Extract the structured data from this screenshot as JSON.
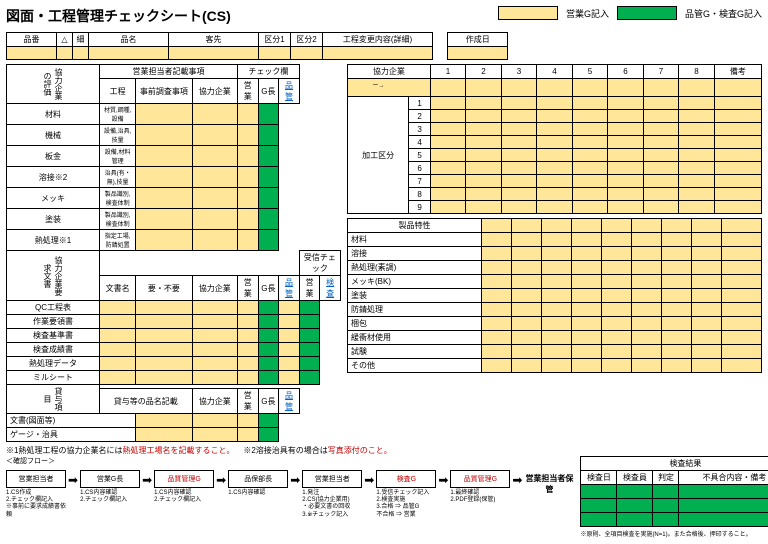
{
  "title": "図面・工程管理チェックシート(CS)",
  "legend": {
    "yellow": "営業G記入",
    "green": "品管G・検査G記入"
  },
  "header": {
    "hinban": "品番",
    "delta": "△",
    "sai": "細",
    "hinmei": "品名",
    "kyakusaki": "客先",
    "kubun1": "区分1",
    "kubun2": "区分2",
    "koutei_henkou": "工程変更内容(詳細)",
    "sakuseibi": "作成日"
  },
  "sales_section": {
    "title": "営業担当者記載事項",
    "check_col": "チェック欄",
    "cols": {
      "koutei": "工程",
      "jizen": "事前調査事項",
      "kyoryoku": "協力企業",
      "eigyo": "営業",
      "gcho": "G長",
      "hinkan": "品管"
    },
    "vlabel": "協力企業の評価",
    "rows": [
      {
        "k": "材料",
        "j": "材質,鋼種,設備"
      },
      {
        "k": "機械",
        "j": "設備,治具,技量"
      },
      {
        "k": "板金",
        "j": "設備,材料管理"
      },
      {
        "k": "溶接※2",
        "j": "治具(有・無),技量"
      },
      {
        "k": "メッキ",
        "j": "製品識別,検査体制"
      },
      {
        "k": "塗装",
        "j": "製品識別,検査体制"
      },
      {
        "k": "熱処理※1",
        "j": "指定工場,防錆処置"
      }
    ],
    "ukeire": "受信チェック",
    "ukeire_cols": {
      "eigyo": "営業",
      "kensa": "検査"
    }
  },
  "doc_section": {
    "vlabel": "協力企業要求文書",
    "cols": {
      "bunsho": "文書名",
      "youhi": "要・不要",
      "kyoryoku": "協力企業",
      "eigyo": "営業",
      "gcho": "G長",
      "hinkan": "品管"
    },
    "rows": [
      "QC工程表",
      "作業要領書",
      "検査基準書",
      "検査成績書",
      "熱処理データ",
      "ミルシート"
    ]
  },
  "lend_section": {
    "vlabel": "貸与項目",
    "title": "貸与等の品名記載",
    "kyoryoku": "協力企業",
    "cols": {
      "eigyo": "営業",
      "gcho": "G長",
      "hinkan": "品管"
    },
    "rows": [
      "文書(図面等)",
      "ゲージ・治具"
    ]
  },
  "coop": {
    "title": "協力企業",
    "num_cols": [
      "1",
      "2",
      "3",
      "4",
      "5",
      "6",
      "7",
      "8"
    ],
    "bikou": "備考",
    "kakou": "加工区分",
    "kakou_rows": [
      "1",
      "2",
      "3",
      "4",
      "5",
      "6",
      "7",
      "8",
      "9"
    ]
  },
  "prod": {
    "title": "製品特性",
    "rows": [
      "材料",
      "溶接",
      "熱処理(素調)",
      "メッキ(BK)",
      "塗装",
      "防錆処理",
      "梱包",
      "緩衝材使用",
      "試験",
      "その他"
    ]
  },
  "notes": {
    "n1a": "※1熱処理工程の協力企業名には",
    "n1b": "熱処理工場名を記載すること。",
    "n2a": "※2溶接治具有の場合は",
    "n2b": "写真添付のこと。"
  },
  "flow": {
    "title": "＜確認フロー＞",
    "boxes": [
      "営業担当者",
      "営業G長",
      "品質管理G",
      "品保部長",
      "営業担当者",
      "検査G",
      "品質管理G"
    ],
    "final": "営業担当者保管",
    "box_colors": [
      "",
      "",
      "r",
      "",
      "",
      "r",
      "r"
    ],
    "notes_list": [
      "1.CS作成\n2.チェック欄記入\n※事前に要求成績書依頼",
      "1.CS内容確認\n2.チェック欄記入",
      "1.CS内容確認\n2.チェック欄記入",
      "1.CS内容確認",
      "1.発注\n2.CS(協力企業用)\n・必要文書の回収\n3.※チェック記入",
      "1.受信チェック記入\n2.検査実施\n3.合格 ⇒ 品管G\n 不合格 ⇒ 営業",
      "1.最終確認\n2.PDF登録(保管)"
    ]
  },
  "result": {
    "title": "検査結果",
    "cols": [
      "検査日",
      "検査員",
      "判定",
      "不具合内容・備考"
    ],
    "note": "※原則、全項目検査を実施(N=1)。また合格後、押印すること。"
  }
}
